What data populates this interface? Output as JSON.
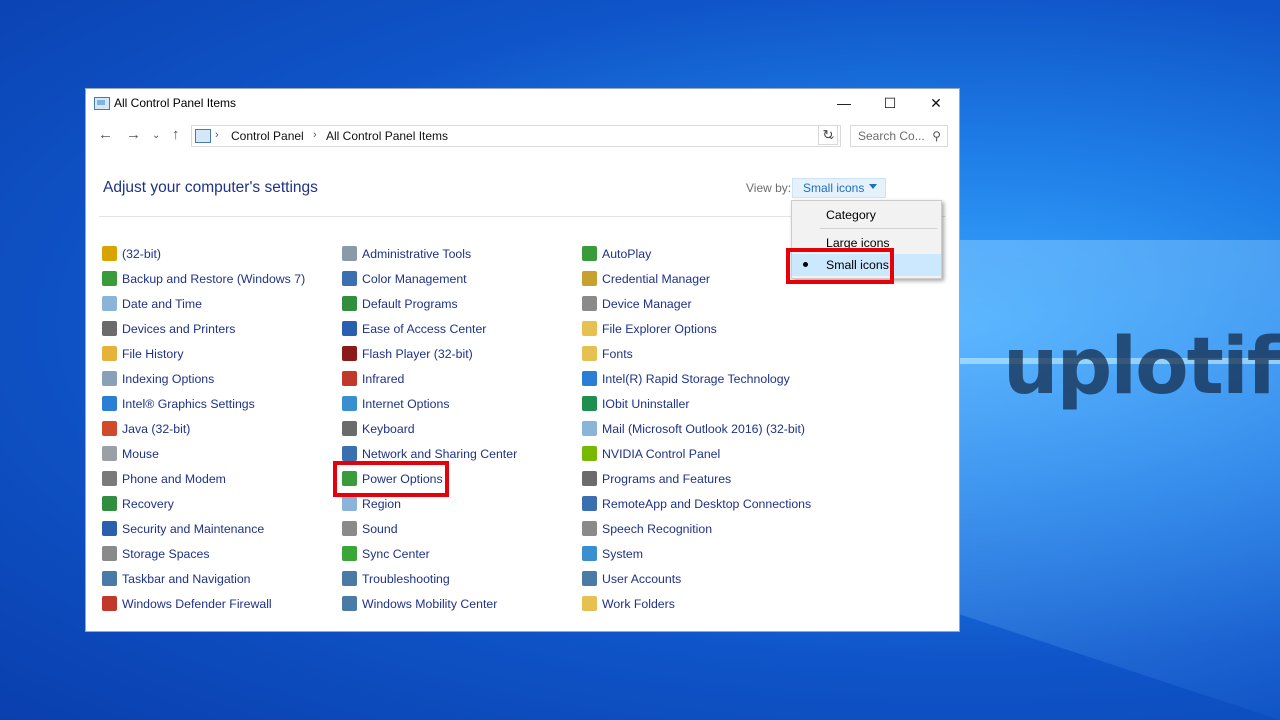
{
  "window": {
    "title": "All Control Panel Items"
  },
  "address": {
    "segments": [
      "Control Panel",
      "All Control Panel Items"
    ],
    "search_placeholder": "Search Co..."
  },
  "content": {
    "heading": "Adjust your computer's settings",
    "view_by_label": "View by:",
    "view_by_value": "Small icons"
  },
  "view_menu": {
    "options": [
      "Category",
      "Large icons",
      "Small icons"
    ],
    "selected": "Small icons"
  },
  "columns": [
    [
      {
        "label": "(32-bit)",
        "icon": "java-cup-icon",
        "color": "#d9a400"
      },
      {
        "label": "Backup and Restore (Windows 7)",
        "icon": "backup-icon",
        "color": "#3a9b3a"
      },
      {
        "label": "Date and Time",
        "icon": "clock-icon",
        "color": "#8ab4d8"
      },
      {
        "label": "Devices and Printers",
        "icon": "printer-icon",
        "color": "#6b6b6b"
      },
      {
        "label": "File History",
        "icon": "file-history-icon",
        "color": "#e6b23c"
      },
      {
        "label": "Indexing Options",
        "icon": "indexing-icon",
        "color": "#8aa0b8"
      },
      {
        "label": "Intel® Graphics Settings",
        "icon": "intel-icon",
        "color": "#2a7fd4"
      },
      {
        "label": "Java (32-bit)",
        "icon": "java-icon",
        "color": "#d04a2a"
      },
      {
        "label": "Mouse",
        "icon": "mouse-icon",
        "color": "#9aa0a6"
      },
      {
        "label": "Phone and Modem",
        "icon": "phone-icon",
        "color": "#7a7a7a"
      },
      {
        "label": "Recovery",
        "icon": "recovery-icon",
        "color": "#2f8f3f"
      },
      {
        "label": "Security and Maintenance",
        "icon": "flag-icon",
        "color": "#2a5fb0"
      },
      {
        "label": "Storage Spaces",
        "icon": "storage-icon",
        "color": "#8a8a8a"
      },
      {
        "label": "Taskbar and Navigation",
        "icon": "taskbar-icon",
        "color": "#4a7aa6"
      },
      {
        "label": "Windows Defender Firewall",
        "icon": "firewall-icon",
        "color": "#c0392b"
      }
    ],
    [
      {
        "label": "Administrative Tools",
        "icon": "admin-tools-icon",
        "color": "#8a9aa8"
      },
      {
        "label": "Color Management",
        "icon": "monitor-icon",
        "color": "#3a6fb0"
      },
      {
        "label": "Default Programs",
        "icon": "default-programs-icon",
        "color": "#2f8f3f"
      },
      {
        "label": "Ease of Access Center",
        "icon": "accessibility-icon",
        "color": "#2a5fb0"
      },
      {
        "label": "Flash Player (32-bit)",
        "icon": "flash-icon",
        "color": "#8b1a1a"
      },
      {
        "label": "Infrared",
        "icon": "infrared-icon",
        "color": "#c0392b"
      },
      {
        "label": "Internet Options",
        "icon": "globe-icon",
        "color": "#3a8fd0"
      },
      {
        "label": "Keyboard",
        "icon": "keyboard-icon",
        "color": "#6b6b6b"
      },
      {
        "label": "Network and Sharing Center",
        "icon": "network-icon",
        "color": "#3a6fb0"
      },
      {
        "label": "Power Options",
        "icon": "power-icon",
        "color": "#3a9b3a"
      },
      {
        "label": "Region",
        "icon": "region-icon",
        "color": "#8ab4d8"
      },
      {
        "label": "Sound",
        "icon": "speaker-icon",
        "color": "#8a8a8a"
      },
      {
        "label": "Sync Center",
        "icon": "sync-icon",
        "color": "#3aa63a"
      },
      {
        "label": "Troubleshooting",
        "icon": "troubleshoot-icon",
        "color": "#4a7aa6"
      },
      {
        "label": "Windows Mobility Center",
        "icon": "mobility-icon",
        "color": "#4a7aa6"
      }
    ],
    [
      {
        "label": "AutoPlay",
        "icon": "autoplay-icon",
        "color": "#3a9b3a"
      },
      {
        "label": "Credential Manager",
        "icon": "credential-icon",
        "color": "#c8a030"
      },
      {
        "label": "Device Manager",
        "icon": "device-manager-icon",
        "color": "#8a8a8a"
      },
      {
        "label": "File Explorer Options",
        "icon": "folder-options-icon",
        "color": "#e6c050"
      },
      {
        "label": "Fonts",
        "icon": "fonts-icon",
        "color": "#e6c050"
      },
      {
        "label": "Intel(R) Rapid Storage Technology",
        "icon": "rst-icon",
        "color": "#2a7fd4"
      },
      {
        "label": "IObit Uninstaller",
        "icon": "iobit-icon",
        "color": "#1f8f4f"
      },
      {
        "label": "Mail (Microsoft Outlook 2016) (32-bit)",
        "icon": "mail-icon",
        "color": "#8ab4d8"
      },
      {
        "label": "NVIDIA Control Panel",
        "icon": "nvidia-icon",
        "color": "#76b900"
      },
      {
        "label": "Programs and Features",
        "icon": "programs-icon",
        "color": "#6b6b6b"
      },
      {
        "label": "RemoteApp and Desktop Connections",
        "icon": "remote-icon",
        "color": "#3a6fb0"
      },
      {
        "label": "Speech Recognition",
        "icon": "microphone-icon",
        "color": "#8a8a8a"
      },
      {
        "label": "System",
        "icon": "system-icon",
        "color": "#3a8fd0"
      },
      {
        "label": "User Accounts",
        "icon": "users-icon",
        "color": "#4a7aa6"
      },
      {
        "label": "Work Folders",
        "icon": "work-folders-icon",
        "color": "#e6c050"
      }
    ]
  ],
  "watermark": "uplotify",
  "highlight_color": "#e5000a"
}
